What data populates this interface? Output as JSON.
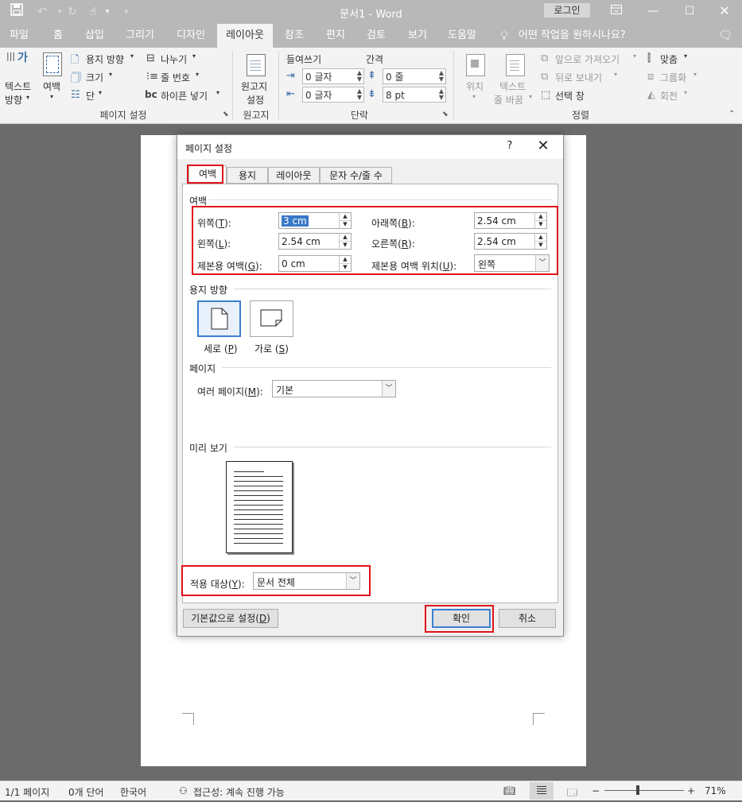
{
  "titlebar": {
    "doc_title": "문서1  -  Word",
    "login": "로그인",
    "qat_icons": [
      "save-icon",
      "undo-icon",
      "redo-icon",
      "touch-mode-icon",
      "customize-qat-icon"
    ],
    "window_icons": [
      "ribbon-display-options-icon",
      "minimize-icon",
      "maximize-icon",
      "close-icon"
    ]
  },
  "ribbon_tabs": [
    "파일",
    "홈",
    "삽입",
    "그리기",
    "디자인",
    "레이아웃",
    "참조",
    "편지",
    "검토",
    "보기",
    "도움말",
    "어떤 작업을 원하시나요?"
  ],
  "active_tab": "레이아웃",
  "ribbon": {
    "page_setup": {
      "text_direction": "텍스트\n방향",
      "text_direction_line1": "텍스트",
      "text_direction_line2": "방향",
      "text_direction_glyph": "가",
      "margins": "여백",
      "orientation": "용지 방향",
      "size": "크기",
      "columns": "단",
      "breaks": "나누기",
      "line_numbers": "줄 번호",
      "hyphenation": "하이픈 넣기",
      "hyphenation_glyph": "bc",
      "label": "페이지 설정"
    },
    "manuscript": {
      "button_line1": "원고지",
      "button_line2": "설정",
      "label": "원고지"
    },
    "paragraph": {
      "indent_header": "들여쓰기",
      "spacing_header": "간격",
      "indent_left": "0 글자",
      "indent_right": "0 글자",
      "spacing_before": "0 줄",
      "spacing_after": "8 pt",
      "label": "단락"
    },
    "arrange": {
      "position": "위치",
      "wrap_text_line1": "텍스트",
      "wrap_text_line2": "줄 바꿈",
      "bring_forward": "앞으로 가져오기",
      "send_backward": "뒤로 보내기",
      "selection_pane": "선택 창",
      "align": "맞춤",
      "group": "그룹화",
      "rotate": "회전",
      "label": "정렬"
    }
  },
  "dialog": {
    "title": "페이지 설정",
    "help": "?",
    "tabs": [
      "여백",
      "용지",
      "레이아웃",
      "문자 수/줄 수"
    ],
    "active_tab": "여백",
    "margins_section": "여백",
    "fields": {
      "top": {
        "label": "위쪽(",
        "key": "T",
        "suffix": "):",
        "value": "3 cm"
      },
      "bottom": {
        "label": "아래쪽(",
        "key": "B",
        "suffix": "):",
        "value": "2.54 cm"
      },
      "left": {
        "label": "왼쪽(",
        "key": "L",
        "suffix": "):",
        "value": "2.54 cm"
      },
      "right": {
        "label": "오른쪽(",
        "key": "R",
        "suffix": "):",
        "value": "2.54 cm"
      },
      "gutter": {
        "label": "제본용 여백(",
        "key": "G",
        "suffix": "):",
        "value": "0 cm"
      },
      "gutter_position": {
        "label": "제본용 여백 위치(",
        "key": "U",
        "suffix": "):",
        "value": "왼쪽"
      }
    },
    "orientation_section": "용지 방향",
    "portrait": {
      "label": "세로 (",
      "key": "P",
      "suffix": ")"
    },
    "landscape": {
      "label": "가로 (",
      "key": "S",
      "suffix": ")"
    },
    "pages_section": "페이지",
    "multiple_pages": {
      "label": "여러 페이지(",
      "key": "M",
      "suffix": "):",
      "value": "기본"
    },
    "preview_section": "미리 보기",
    "apply_to": {
      "label": "적용 대상(",
      "key": "Y",
      "suffix": "):",
      "value": "문서 전체"
    },
    "set_default": {
      "label": "기본값으로 설정(",
      "key": "D",
      "suffix": ")"
    },
    "ok": "확인",
    "cancel": "취소"
  },
  "statusbar": {
    "page": "1/1 페이지",
    "words": "0개 단어",
    "language": "한국어",
    "accessibility": "접근성: 계속 진행 가능",
    "zoom_minus": "−",
    "zoom_plus": "+",
    "zoom": "71%",
    "zoom_level": 0.42
  },
  "colors": {
    "titlebar": "#b8b8b8",
    "ribbon": "#f3f3f3",
    "workspace": "#6b6b6b",
    "highlight_red": "#e0121a",
    "accent_blue": "#3c7fd1"
  }
}
